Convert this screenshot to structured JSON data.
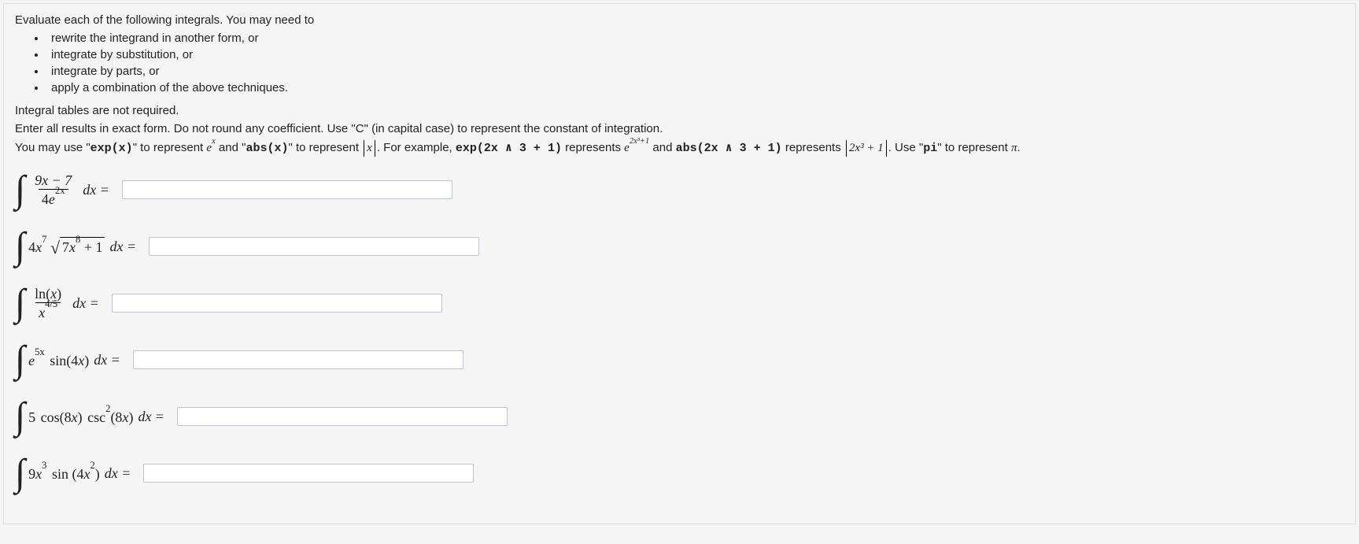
{
  "instructions": {
    "intro": "Evaluate each of the following integrals. You may need to",
    "bullets": [
      "rewrite the integrand in another form, or",
      "integrate by substitution, or",
      "integrate by parts, or",
      "apply a combination of the above techniques."
    ],
    "note": "Integral tables are not required.",
    "exact_form": "Enter all results in exact form. Do not round any coefficient. Use \"C\" (in capital case) to represent the constant of integration.",
    "syntax_prefix": "You may use \"",
    "exp_code": "exp(x)",
    "syntax_mid1": "\" to represent ",
    "exp_math": "e",
    "exp_sup": "x",
    "syntax_mid2": " and \"",
    "abs_code": "abs(x)",
    "syntax_mid3": "\" to represent ",
    "abs_math": "x",
    "syntax_mid4": ". For example, ",
    "example_exp_code": "exp(2x ∧ 3 + 1)",
    "syntax_mid5": " represents ",
    "example_exp_base": "e",
    "example_exp_pow": "2x³+1",
    "syntax_mid6": " and ",
    "example_abs_code": "abs(2x ∧ 3 + 1)",
    "syntax_mid7": " represents ",
    "example_abs_inner": "2x³ + 1",
    "syntax_mid8": ". Use \"",
    "pi_code": "pi",
    "syntax_mid9": "\" to represent ",
    "pi_sym": "π",
    "syntax_end": "."
  },
  "problems": {
    "p1": {
      "num": "9x − 7",
      "den_coeff": "4",
      "den_exp_base": "e",
      "den_exp_pow": "2x",
      "dx": "dx ="
    },
    "p2": {
      "coeff": "4",
      "x_pow": "7",
      "inside_coeff": "7",
      "inside_x_pow": "8",
      "inside_plus": "+ 1",
      "dx": "dx ="
    },
    "p3": {
      "num": "ln(x)",
      "den_base": "x",
      "den_exp": "4/5",
      "dx": "dx ="
    },
    "p4": {
      "e_base": "e",
      "e_pow": "5x",
      "trig": "sin(4x)",
      "dx": "dx ="
    },
    "p5": {
      "coeff": "5",
      "cos": "cos(8x)",
      "csc_base": "csc",
      "csc_pow": "2",
      "csc_arg": "(8x)",
      "dx": "dx ="
    },
    "p6": {
      "coeff": "9",
      "x_base": "x",
      "x_pow": "3",
      "sin": "sin",
      "arg_coeff": "4",
      "arg_x": "x",
      "arg_pow": "2",
      "dx": "dx ="
    }
  }
}
